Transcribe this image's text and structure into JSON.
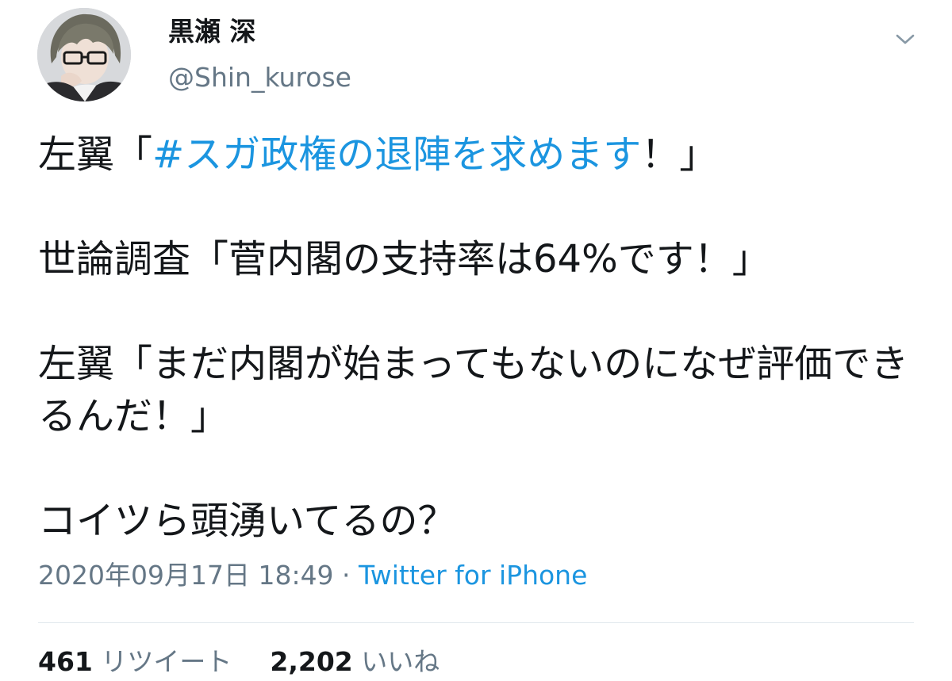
{
  "tweet": {
    "author": {
      "display_name": "黒瀬 深",
      "handle": "@Shin_kurose"
    },
    "body": {
      "p1_prefix": "左翼「",
      "p1_hashtag": "#スガ政権の退陣を求めます",
      "p1_suffix": "！」",
      "p2": "世論調査「菅内閣の支持率は64%です！」",
      "p3": "左翼「まだ内閣が始まってもないのになぜ評価できるんだ！」",
      "p4": "コイツら頭湧いてるの？"
    },
    "meta": {
      "timestamp": "2020年09月17日 18:49",
      "separator": " · ",
      "source": "Twitter for iPhone"
    },
    "stats": {
      "retweets_count": "461",
      "retweets_label": "リツイート",
      "likes_count": "2,202",
      "likes_label": "いいね"
    },
    "colors": {
      "link": "#1b95e0",
      "secondary_text": "#657786",
      "primary_text": "#14171a"
    },
    "icons": {
      "menu": "chevron-down-icon",
      "avatar": "avatar"
    }
  }
}
